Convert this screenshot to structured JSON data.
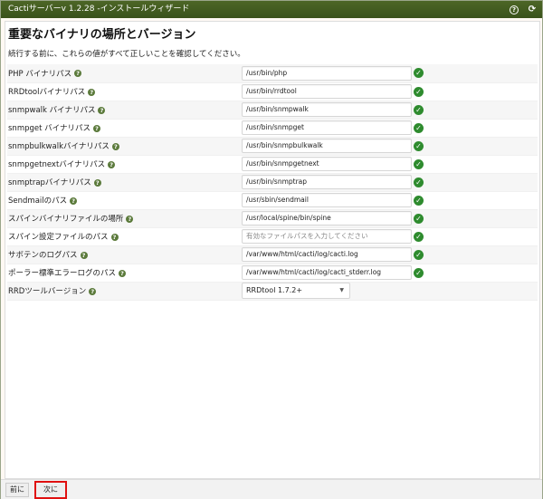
{
  "window": {
    "title": "Cactiサーバーv 1.2.28 -インストールウィザード"
  },
  "titlebar_icons": [
    "help-icon",
    "refresh-icon"
  ],
  "page": {
    "heading": "重要なバイナリの場所とバージョン",
    "intro": "続行する前に、これらの値がすべて正しいことを確認してください。"
  },
  "rows": [
    {
      "label": "PHP バイナリパス",
      "value": "/usr/bin/php",
      "placeholder": false,
      "ok": true
    },
    {
      "label": "RRDtoolバイナリパス",
      "value": "/usr/bin/rrdtool",
      "placeholder": false,
      "ok": true
    },
    {
      "label": "snmpwalk バイナリパス",
      "value": "/usr/bin/snmpwalk",
      "placeholder": false,
      "ok": true
    },
    {
      "label": "snmpget バイナリパス",
      "value": "/usr/bin/snmpget",
      "placeholder": false,
      "ok": true
    },
    {
      "label": "snmpbulkwalkバイナリパス",
      "value": "/usr/bin/snmpbulkwalk",
      "placeholder": false,
      "ok": true
    },
    {
      "label": "snmpgetnextバイナリパス",
      "value": "/usr/bin/snmpgetnext",
      "placeholder": false,
      "ok": true
    },
    {
      "label": "snmptrapバイナリパス",
      "value": "/usr/bin/snmptrap",
      "placeholder": false,
      "ok": true
    },
    {
      "label": "Sendmailのパス",
      "value": "/usr/sbin/sendmail",
      "placeholder": false,
      "ok": true
    },
    {
      "label": "スパインバイナリファイルの場所",
      "value": "/usr/local/spine/bin/spine",
      "placeholder": false,
      "ok": true
    },
    {
      "label": "スパイン設定ファイルのパス",
      "value": "有効なファイルパスを入力してください",
      "placeholder": true,
      "ok": true
    },
    {
      "label": "サボテンのログパス",
      "value": "/var/www/html/cacti/log/cacti.log",
      "placeholder": false,
      "ok": true
    },
    {
      "label": "ポーラー標準エラーログのパス",
      "value": "/var/www/html/cacti/log/cacti_stderr.log",
      "placeholder": false,
      "ok": true
    }
  ],
  "rrd_version": {
    "label": "RRDツールバージョン",
    "selected": "RRDtool 1.7.2+"
  },
  "footer": {
    "prev_label": "前に",
    "next_label": "次に"
  },
  "colors": {
    "titlebar": "#46601f",
    "ok": "#2e8b2e",
    "help": "#5b7a3b",
    "highlight": "#e01010"
  }
}
